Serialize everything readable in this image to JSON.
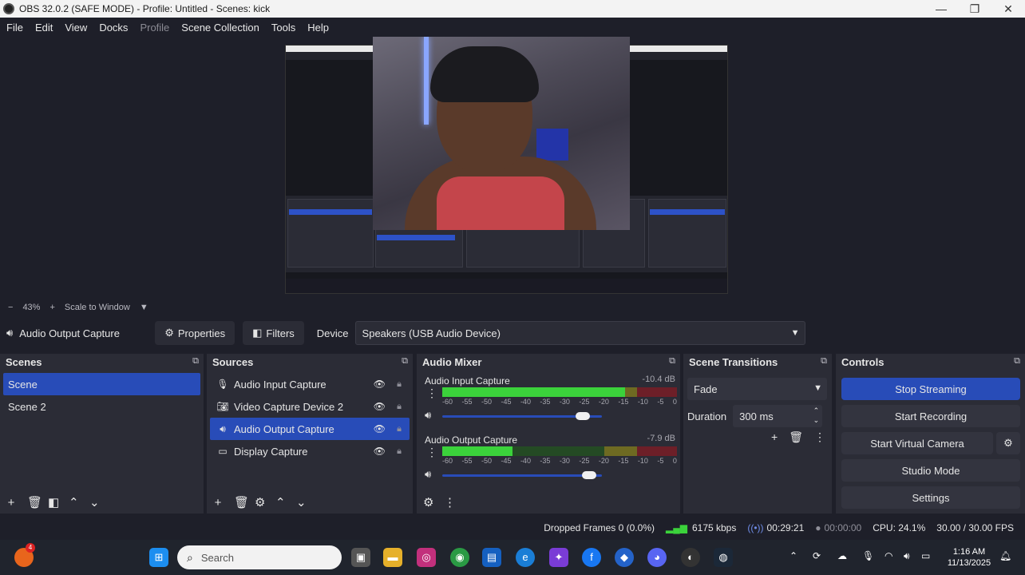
{
  "window": {
    "title": "OBS 32.0.2 (SAFE MODE) - Profile: Untitled - Scenes: kick",
    "minimize": "—",
    "maximize": "❐",
    "close": "✕"
  },
  "menu": [
    "File",
    "Edit",
    "View",
    "Docks",
    "Profile",
    "Scene Collection",
    "Tools",
    "Help"
  ],
  "zoom": {
    "minus": "−",
    "value": "43%",
    "plus": "+",
    "mode": "Scale to Window"
  },
  "context": {
    "source_name": "Audio Output Capture",
    "properties_label": "Properties",
    "filters_label": "Filters",
    "device_label": "Device",
    "device_value": "Speakers (USB Audio Device)"
  },
  "scenes": {
    "title": "Scenes",
    "items": [
      "Scene",
      "Scene 2"
    ],
    "selected": "Scene"
  },
  "sources": {
    "title": "Sources",
    "items": [
      {
        "label": "Audio Input Capture",
        "icon": "microphone-icon"
      },
      {
        "label": "Video Capture Device 2",
        "icon": "camera-icon"
      },
      {
        "label": "Audio Output Capture",
        "icon": "speaker-icon"
      },
      {
        "label": "Display Capture",
        "icon": "monitor-icon"
      }
    ],
    "selected": "Audio Output Capture"
  },
  "mixer": {
    "title": "Audio Mixer",
    "channels": [
      {
        "name": "Audio Input Capture",
        "db": "-10.4 dB",
        "level": 0.78,
        "volume": 0.88
      },
      {
        "name": "Audio Output Capture",
        "db": "-7.9 dB",
        "level": 0.3,
        "volume": 0.92
      }
    ],
    "ticks": [
      "-60",
      "-55",
      "-50",
      "-45",
      "-40",
      "-35",
      "-30",
      "-25",
      "-20",
      "-15",
      "-10",
      "-5",
      "0"
    ]
  },
  "transitions": {
    "title": "Scene Transitions",
    "selected": "Fade",
    "duration_label": "Duration",
    "duration_value": "300 ms"
  },
  "controls": {
    "title": "Controls",
    "stop_streaming": "Stop Streaming",
    "start_recording": "Start Recording",
    "start_virtual_camera": "Start Virtual Camera",
    "studio_mode": "Studio Mode",
    "settings": "Settings"
  },
  "status": {
    "dropped_frames": "Dropped Frames 0 (0.0%)",
    "bitrate": "6175 kbps",
    "stream_time": "00:29:21",
    "record_time": "00:00:00",
    "cpu": "CPU: 24.1%",
    "fps": "30.00 / 30.00 FPS"
  },
  "taskbar": {
    "search_placeholder": "Search",
    "notification_badge": "4",
    "time": "1:16 AM",
    "date": "11/13/2025"
  },
  "colors": {
    "accent": "#284cb8",
    "meter_green": "#3bd23b",
    "panel_bg": "#2b2c36",
    "window_bg": "#1e1f29"
  }
}
